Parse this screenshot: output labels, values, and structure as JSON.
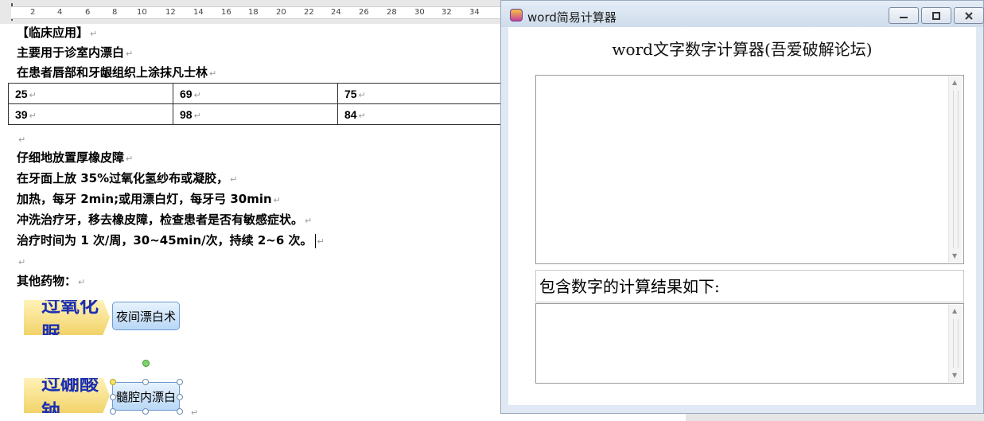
{
  "ruler": {
    "ticks": [
      "2",
      "4",
      "6",
      "8",
      "10",
      "12",
      "14",
      "16",
      "18",
      "20",
      "22",
      "24",
      "26",
      "28",
      "30",
      "32",
      "34"
    ]
  },
  "document": {
    "lines": {
      "heading": "【临床应用】",
      "l1": "主要用于诊室内漂白",
      "l2": "在患者唇部和牙龈组织上涂抹凡士林",
      "l3": "仔细地放置厚橡皮障",
      "l4": "在牙面上放 35%过氧化氢纱布或凝胶，",
      "l5": "加热，每牙 2min;或用漂白灯，每牙弓 30min",
      "l6": "冲洗治疗牙，移去橡皮障，检查患者是否有敏感症状。",
      "l7": "治疗时间为 1 次/周，30~45min/次，持续 2~6 次。",
      "l8": "其他药物："
    },
    "paragraph_mark": "↵",
    "table": [
      [
        "25",
        "69",
        "75"
      ],
      [
        "39",
        "98",
        "84"
      ]
    ],
    "shapes": [
      {
        "arrow": "过氧化脲",
        "box": "夜间漂白术"
      },
      {
        "arrow": "过硼酸钠",
        "box": "髓腔内漂白"
      }
    ]
  },
  "calculator": {
    "window_title": "word简易计算器",
    "heading": "word文字数字计算器(吾爱破解论坛)",
    "input_text": "",
    "result_label": "包含数字的计算结果如下:",
    "result_text": "",
    "buttons": {
      "minimize": "minimize-icon",
      "maximize": "maximize-icon",
      "close": "close-icon"
    }
  }
}
